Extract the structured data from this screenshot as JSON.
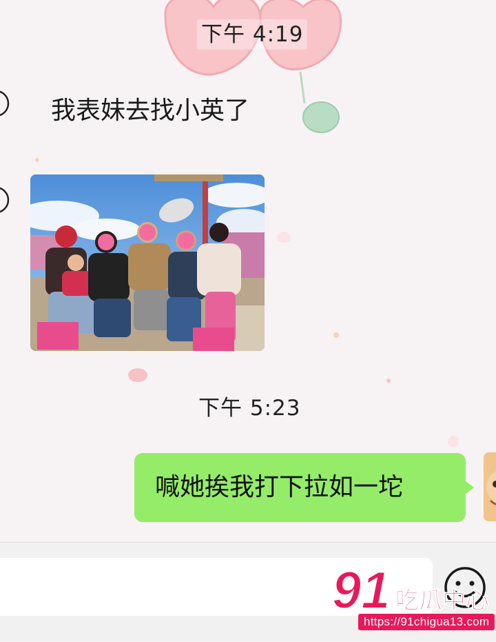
{
  "chat": {
    "timestamps": [
      "下午 4:19",
      "下午 5:23"
    ],
    "messages": [
      {
        "direction": "incoming",
        "type": "text",
        "text": "我表妹去找小英了"
      },
      {
        "direction": "incoming",
        "type": "image"
      },
      {
        "direction": "outgoing",
        "type": "text",
        "text": "喊她挨我打下拉如一坨"
      }
    ]
  },
  "input_bar": {
    "emoji_icon": "emoji-face-icon"
  },
  "watermark": {
    "logo_text": "91吃瓜中心",
    "url": "https://91chigua13.com"
  },
  "colors": {
    "outgoing_bubble": "#95ec69",
    "watermark_pink": "#e8195a",
    "background": "#f7f3f4"
  }
}
